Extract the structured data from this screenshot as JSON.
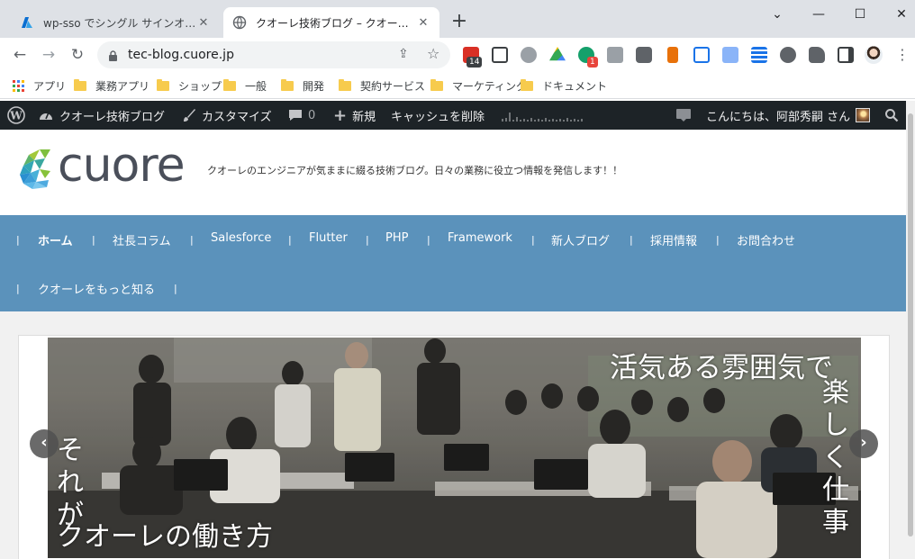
{
  "browser": {
    "tabs": [
      {
        "title": "wp-sso でシングル サインオンをTest -",
        "close": "✕",
        "favicon": "azure-logo-icon"
      },
      {
        "title": "クオーレ技術ブログ – クオーレのエンジニ",
        "close": "✕",
        "favicon": "globe-icon"
      }
    ],
    "new_tab": "+",
    "window_controls": {
      "tabsearch": "⌄",
      "minimize": "—",
      "maximize": "☐",
      "close": "✕"
    },
    "url": "tec-blog.cuore.jp",
    "extension_badges": {
      "calendar": "14",
      "grammarly": "1"
    },
    "bookmarks": [
      "アプリ",
      "業務アプリ",
      "ショップ",
      "一般",
      "開発",
      "契約サービス",
      "マーケティング",
      "ドキュメント"
    ]
  },
  "adminbar": {
    "site_name": "クオーレ技術ブログ",
    "customize": "カスタマイズ",
    "comments_count": "0",
    "new_label": "新規",
    "purge_cache": "キャッシュを削除",
    "greeting": "こんにちは、阿部秀嗣 さん"
  },
  "site": {
    "logo_text": "cuore",
    "tagline": "クオーレのエンジニアが気ままに綴る技術ブログ。日々の業務に役立つ情報を発信します！！"
  },
  "nav": {
    "separator": "|",
    "items": [
      "ホーム",
      "社長コラム",
      "Salesforce",
      "Flutter",
      "PHP",
      "Framework",
      "新人ブログ",
      "採用情報",
      "お問合わせ",
      "クオーレをもっと知る"
    ]
  },
  "slider": {
    "line1": "活気ある雰囲気で",
    "vertical_right": [
      "楽",
      "し",
      "く",
      "仕",
      "事"
    ],
    "vertical_left": [
      "そ",
      "れ",
      "が"
    ],
    "bottom_left": "クオーレの働き方",
    "prev": "‹",
    "next": "›"
  },
  "colors": {
    "nav_bg": "#5b92bb",
    "adminbar_bg": "#1d2327",
    "tabstrip_bg": "#dee1e6"
  }
}
